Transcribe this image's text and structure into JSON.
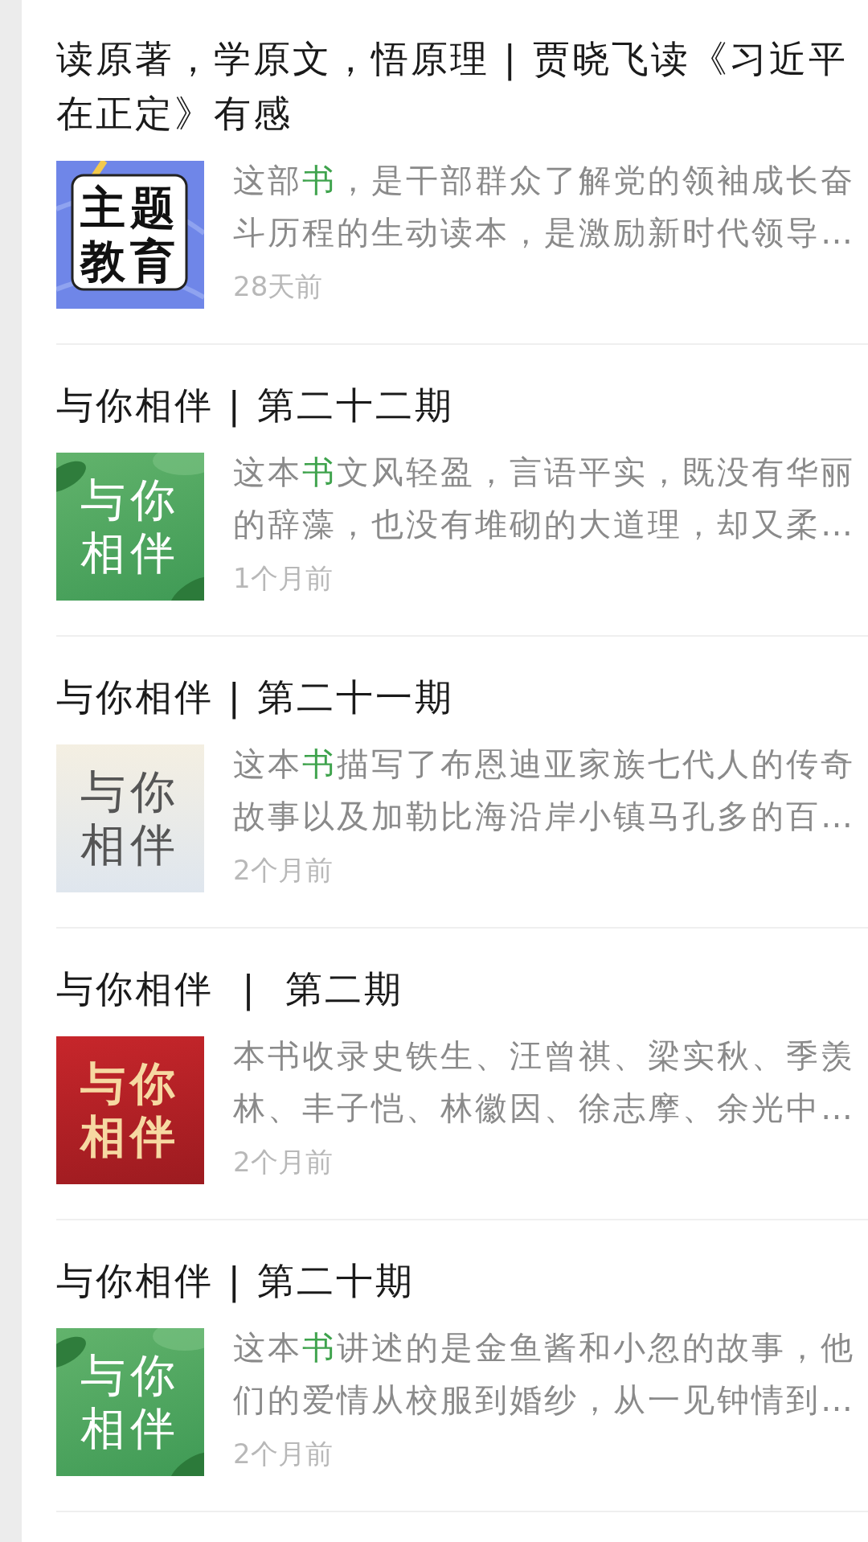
{
  "articles": [
    {
      "title": "读原著，学原文，悟原理 | 贾晓飞读《习近平在正定》有感",
      "thumbnail": {
        "kind": "card",
        "lines": [
          "主题",
          "教育"
        ]
      },
      "summary": [
        {
          "text": "这部",
          "highlight": false
        },
        {
          "text": "书",
          "highlight": true
        },
        {
          "text": "，是干部群众了解党的领袖成长奋斗历程的生动读本，是激励新时代领导…",
          "highlight": false
        }
      ],
      "time": "28天前"
    },
    {
      "title": "与你相伴 | 第二十二期",
      "thumbnail": {
        "kind": "green",
        "lines": [
          "与你",
          "相伴"
        ]
      },
      "summary": [
        {
          "text": "这本",
          "highlight": false
        },
        {
          "text": "书",
          "highlight": true
        },
        {
          "text": "文风轻盈，言语平实，既没有华丽的辞藻，也没有堆砌的大道理，却又柔…",
          "highlight": false
        }
      ],
      "time": "1个月前"
    },
    {
      "title": "与你相伴 | 第二十一期",
      "thumbnail": {
        "kind": "cream",
        "lines": [
          "与你",
          "相伴"
        ]
      },
      "summary": [
        {
          "text": "这本",
          "highlight": false
        },
        {
          "text": "书",
          "highlight": true
        },
        {
          "text": "描写了布恩迪亚家族七代人的传奇故事以及加勒比海沿岸小镇马孔多的百…",
          "highlight": false
        }
      ],
      "time": "2个月前"
    },
    {
      "title": "与你相伴  |  第二期",
      "thumbnail": {
        "kind": "red",
        "lines": [
          "与你",
          "相伴"
        ]
      },
      "summary": [
        {
          "text": "本书收录史铁生、汪曾祺、梁实秋、季羡林、丰子恺、林徽因、徐志摩、余光中…",
          "highlight": false
        }
      ],
      "time": "2个月前"
    },
    {
      "title": "与你相伴 | 第二十期",
      "thumbnail": {
        "kind": "green",
        "lines": [
          "与你",
          "相伴"
        ]
      },
      "summary": [
        {
          "text": "这本",
          "highlight": false
        },
        {
          "text": "书",
          "highlight": true
        },
        {
          "text": "讲述的是金鱼酱和小忽的故事，他们的爱情从校服到婚纱，从一见钟情到…",
          "highlight": false
        }
      ],
      "time": "2个月前"
    }
  ]
}
